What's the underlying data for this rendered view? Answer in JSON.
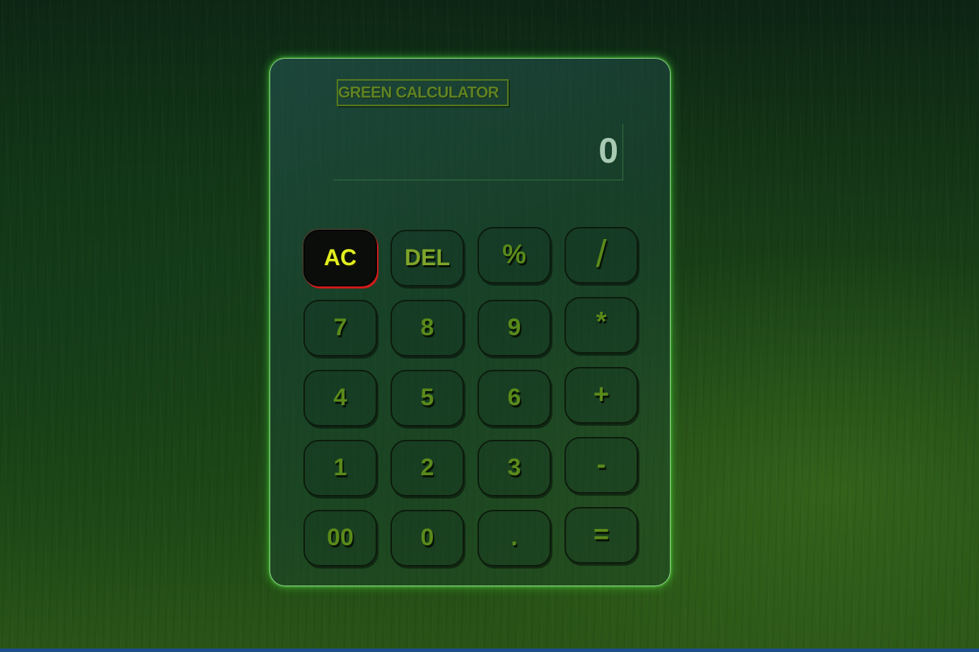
{
  "app": {
    "title": "GREEN CALCULATOR"
  },
  "display": {
    "value": "0"
  },
  "keys": {
    "ac": "AC",
    "del": "DEL",
    "percent": "%",
    "divide": "/",
    "seven": "7",
    "eight": "8",
    "nine": "9",
    "multiply": "*",
    "four": "4",
    "five": "5",
    "six": "6",
    "plus": "+",
    "one": "1",
    "two": "2",
    "three": "3",
    "minus": "-",
    "double_zero": "00",
    "zero": "0",
    "dot": ".",
    "equals": "="
  },
  "colors": {
    "glow": "#8fd98a",
    "ac_text": "#e2ee1e",
    "ac_accent": "#d11a1a",
    "key_text": "#5a8a1a",
    "display_text": "#a9c9b3",
    "bottom_bar": "#1d4f8a"
  }
}
